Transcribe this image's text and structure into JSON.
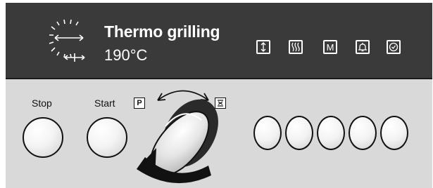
{
  "display": {
    "mode_name": "Thermo grilling",
    "temperature": "190°C",
    "mode_icon": "thermo-grill-fan-icon",
    "function_icons": [
      "defrost-icon",
      "grill-heat-icon",
      "memory-m-icon",
      "timer-bell-icon",
      "clock-icon"
    ],
    "memory_symbol": "M"
  },
  "controls": {
    "stop_label": "Stop",
    "start_label": "Start",
    "selector_start_mark": "P",
    "selector_end_icon": "grill-mode-icon",
    "memory_buttons_count": 5
  },
  "colors": {
    "display_bg": "#3a3a3a",
    "panel_bg": "#d9d9d9",
    "text_on_display": "#ffffff"
  }
}
